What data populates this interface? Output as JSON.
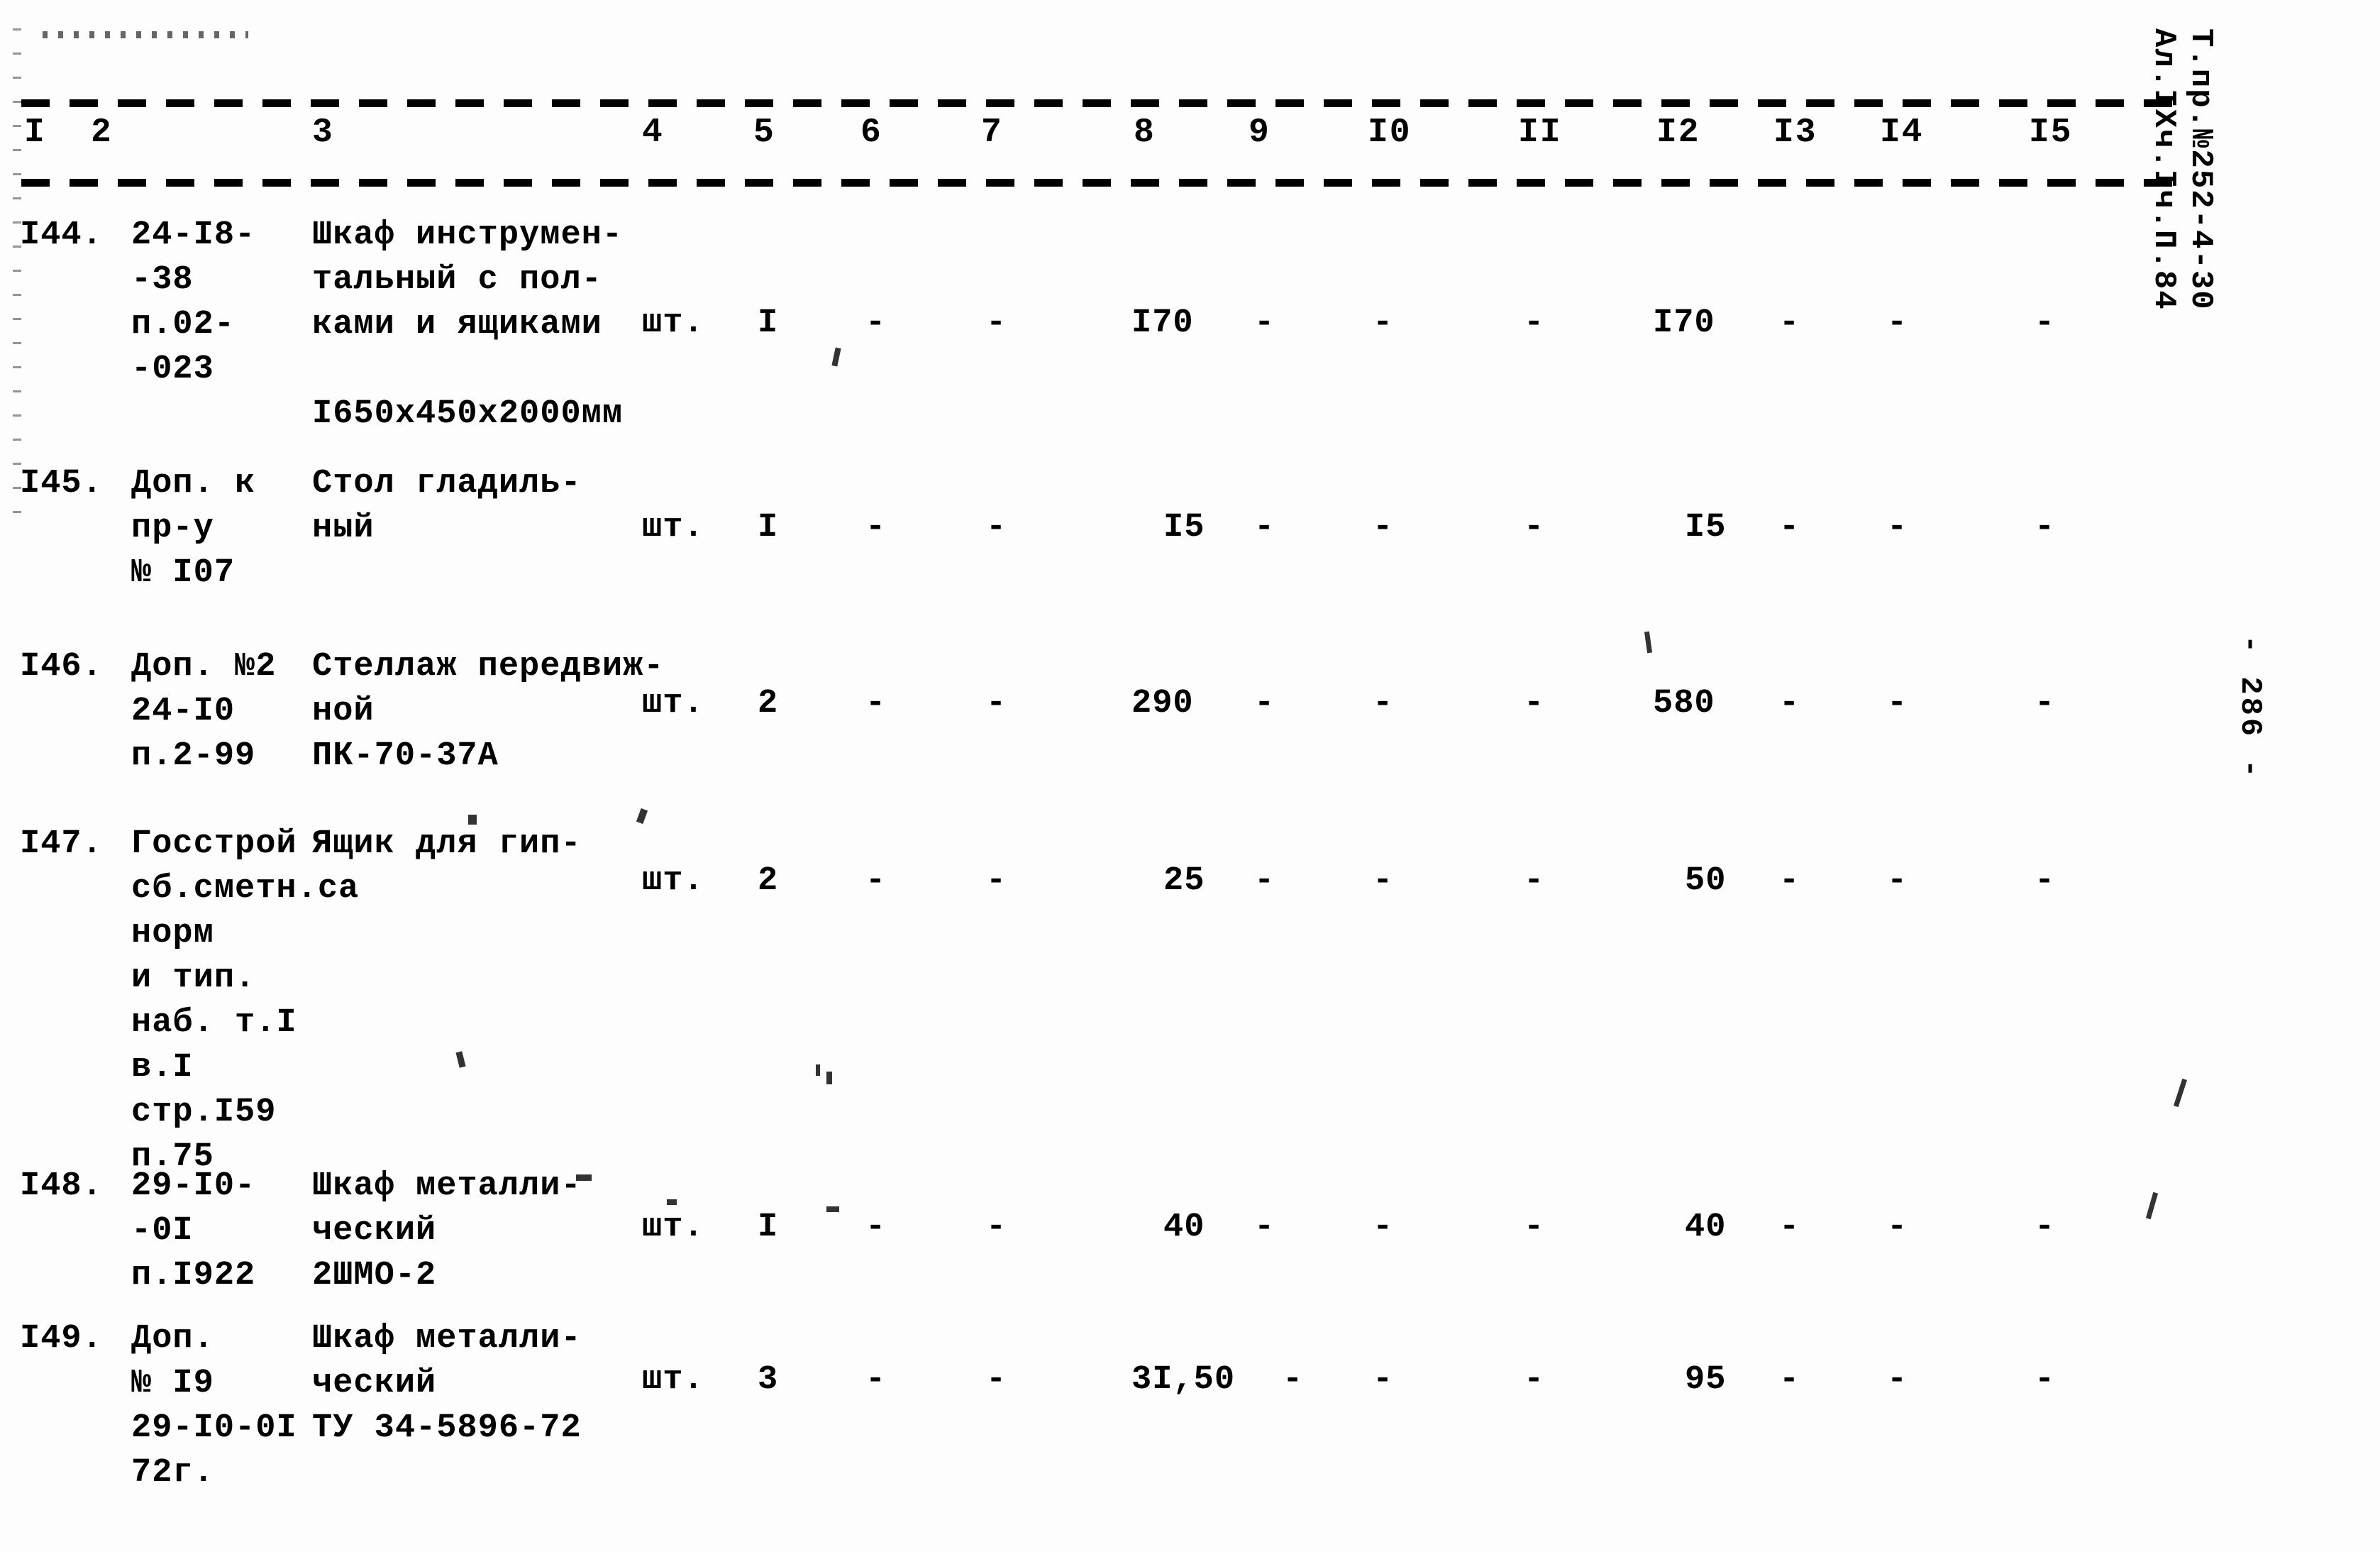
{
  "document": {
    "page_number_marker": "- 286 -",
    "margin_stamp_line1": "Т.пр.№252-4-30",
    "margin_stamp_line2": "Ал.IХч.Iч.П.84"
  },
  "table": {
    "column_headers": [
      "I",
      "2",
      "3",
      "4",
      "5",
      "6",
      "7",
      "8",
      "9",
      "I0",
      "II",
      "I2",
      "I3",
      "I4",
      "I5"
    ],
    "rows": [
      {
        "no": "I44.",
        "code": "24-I8-\n-38\nп.02-\n-023",
        "name": "Шкаф инструмен-\nтальный с пол-\nками и ящиками\n\nI650х450х2000мм",
        "unit": "шт.",
        "c5": "I",
        "c6": "-",
        "c7": "-",
        "c8": "I70",
        "c9": "-",
        "c10": "-",
        "c11": "-",
        "c12": "I70",
        "c13": "-",
        "c14": "-",
        "c15": "-"
      },
      {
        "no": "I45.",
        "code": "Доп. к\nпр-у\n№ I07",
        "name": "Стол гладиль-\nный",
        "unit": "шт.",
        "c5": "I",
        "c6": "-",
        "c7": "-",
        "c8": "I5",
        "c9": "-",
        "c10": "-",
        "c11": "-",
        "c12": "I5",
        "c13": "-",
        "c14": "-",
        "c15": "-"
      },
      {
        "no": "I46.",
        "code": "Доп. №2\n24-I0\nп.2-99",
        "name": "Стеллаж передвиж-\nной\nПК-70-37А",
        "unit": "шт.",
        "c5": "2",
        "c6": "-",
        "c7": "-",
        "c8": "290",
        "c9": "-",
        "c10": "-",
        "c11": "-",
        "c12": "580",
        "c13": "-",
        "c14": "-",
        "c15": "-"
      },
      {
        "no": "I47.",
        "code": "Госстрой\nсб.сметн.са\nнорм\nи тип.\nнаб. т.I\nв.I\nстр.I59\nп.75",
        "name": "Ящик для гип-",
        "unit": "шт.",
        "c5": "2",
        "c6": "-",
        "c7": "-",
        "c8": "25",
        "c9": "-",
        "c10": "-",
        "c11": "-",
        "c12": "50",
        "c13": "-",
        "c14": "-",
        "c15": "-"
      },
      {
        "no": "I48.",
        "code": "29-I0-\n-0I\nп.I922",
        "name": "Шкаф металли-\nческий\n2ШМО-2",
        "unit": "шт.",
        "c5": "I",
        "c6": "-",
        "c7": "-",
        "c8": "40",
        "c9": "-",
        "c10": "-",
        "c11": "-",
        "c12": "40",
        "c13": "-",
        "c14": "-",
        "c15": "-"
      },
      {
        "no": "I49.",
        "code": "Доп.\n№ I9\n29-I0-0I\n72г.",
        "name": "Шкаф металли-\nческий\nТУ 34-5896-72",
        "unit": "шт.",
        "c5": "3",
        "c6": "-",
        "c7": "-",
        "c8": "3I,50",
        "c9": "-",
        "c10": "-",
        "c11": "-",
        "c12": "95",
        "c13": "-",
        "c14": "-",
        "c15": "-"
      }
    ]
  }
}
